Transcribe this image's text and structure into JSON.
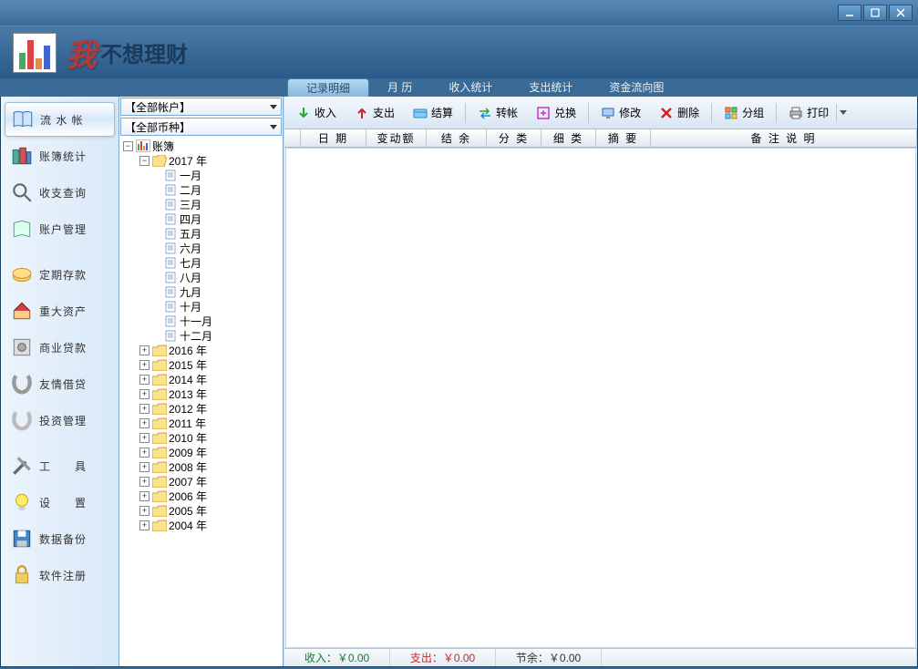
{
  "app": {
    "name_pre": "我",
    "name_post": "不想理财"
  },
  "tabs": {
    "t0": "记录明细",
    "t1": "月 历",
    "t2": "收入统计",
    "t3": "支出统计",
    "t4": "资金流向图"
  },
  "sidebar": {
    "s0": "流 水 帐",
    "s1": "账簿统计",
    "s2": "收支查询",
    "s3": "账户管理",
    "s4": "定期存款",
    "s5": "重大资产",
    "s6": "商业贷款",
    "s7": "友情借贷",
    "s8": "投资管理",
    "s9": "工　　具",
    "s10": "设　　置",
    "s11": "数据备份",
    "s12": "软件注册"
  },
  "dropdowns": {
    "d0": "【全部帐户】",
    "d1": "【全部币种】"
  },
  "tree": {
    "root": "账簿",
    "year_open": "2017 年",
    "months": [
      "一月",
      "二月",
      "三月",
      "四月",
      "五月",
      "六月",
      "七月",
      "八月",
      "九月",
      "十月",
      "十一月",
      "十二月"
    ],
    "years_closed": [
      "2016 年",
      "2015 年",
      "2014 年",
      "2013 年",
      "2012 年",
      "2011 年",
      "2010 年",
      "2009 年",
      "2008 年",
      "2007 年",
      "2006 年",
      "2005 年",
      "2004 年"
    ]
  },
  "toolbar": {
    "b0": "收入",
    "b1": "支出",
    "b2": "结算",
    "b3": "转帐",
    "b4": "兑换",
    "b5": "修改",
    "b6": "删除",
    "b7": "分组",
    "b8": "打印"
  },
  "grid": {
    "c0": "日 期",
    "c1": "变动额",
    "c2": "结 余",
    "c3": "分 类",
    "c4": "细 类",
    "c5": "摘 要",
    "c6": "备 注 说 明"
  },
  "status": {
    "in": "收入：￥0.00",
    "out": "支出：￥0.00",
    "bal": "节余：￥0.00"
  }
}
